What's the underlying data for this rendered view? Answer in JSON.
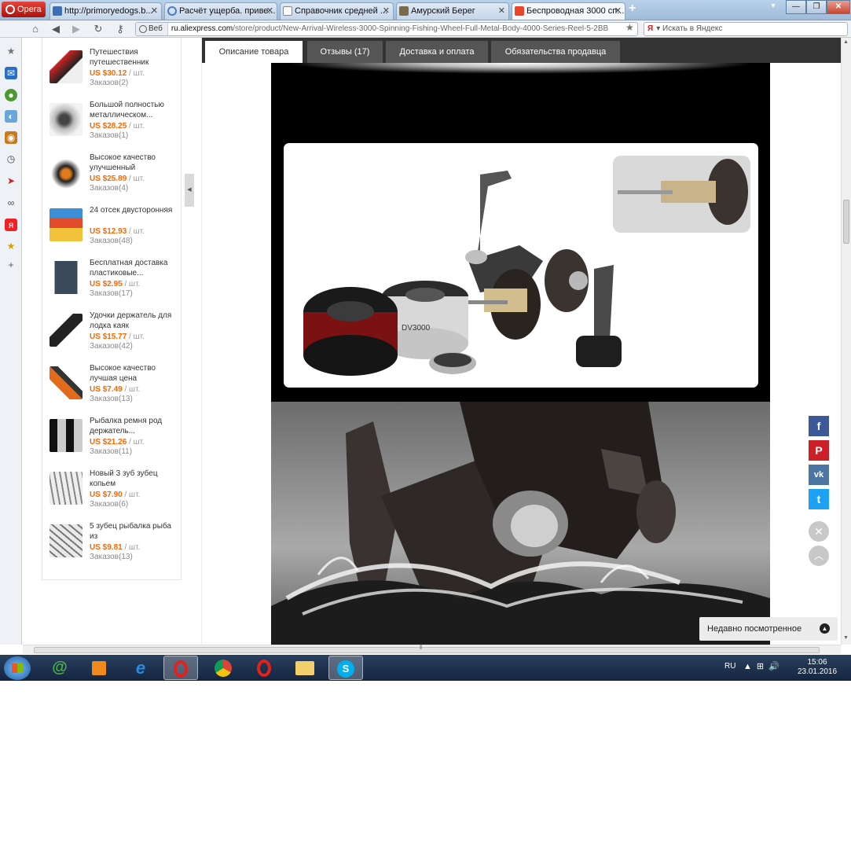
{
  "browser": {
    "menu_label": "Opera",
    "tabs": [
      {
        "title": "http://primoryedogs.b...",
        "color": "#3b6fb5"
      },
      {
        "title": "Расчёт ущерба. приве...",
        "color": "#4a7bc4"
      },
      {
        "title": "Справочник средней ...",
        "color": "#ffffff"
      },
      {
        "title": "Амурский Берег",
        "color": "#7a6a4a"
      },
      {
        "title": "Беспроводная 3000 сп...",
        "color": "#e8452c"
      }
    ],
    "address": {
      "web_badge": "Веб",
      "url_host": "ru.aliexpress.com",
      "url_path": "/store/product/New-Arrival-Wireless-3000-Spinning-Fishing-Wheel-Full-Metal-Body-4000-Series-Reel-5-2BB"
    },
    "search_placeholder": "Искать в Яндекс",
    "search_engine_badge": "Я"
  },
  "recommended": [
    {
      "title": "Путешествия путешественник",
      "price": "US $30.12",
      "unit": "/ шт.",
      "orders": "Заказов(2)"
    },
    {
      "title": "Большой полностью металлическом...",
      "price": "US $28.25",
      "unit": "/ шт.",
      "orders": "Заказов(1)"
    },
    {
      "title": "Высокое качество улучшенный",
      "price": "US $25.89",
      "unit": "/ шт.",
      "orders": "Заказов(4)"
    },
    {
      "title": "24 отсек двусторонняя",
      "price": "US $12.93",
      "unit": "/ шт.",
      "orders": "Заказов(48)"
    },
    {
      "title": "Бесплатная доставка пластиковые...",
      "price": "US $2.95",
      "unit": "/ шт.",
      "orders": "Заказов(17)"
    },
    {
      "title": "Удочки держатель для лодка каяк",
      "price": "US $15.77",
      "unit": "/ шт.",
      "orders": "Заказов(42)"
    },
    {
      "title": "Высокое качество лучшая цена",
      "price": "US $7.49",
      "unit": "/ шт.",
      "orders": "Заказов(13)"
    },
    {
      "title": "Рыбалка ремня род держатель...",
      "price": "US $21.26",
      "unit": "/ шт.",
      "orders": "Заказов(11)"
    },
    {
      "title": "Новый 3 зуб зубец копьем",
      "price": "US $7.90",
      "unit": "/ шт.",
      "orders": "Заказов(6)"
    },
    {
      "title": "5 зубец рыбалка рыба из",
      "price": "US $9.81",
      "unit": "/ шт.",
      "orders": "Заказов(13)"
    }
  ],
  "product_tabs": [
    {
      "label": "Описание товара"
    },
    {
      "label": "Отзывы (17)"
    },
    {
      "label": "Доставка и оплата"
    },
    {
      "label": "Обязательства продавца"
    }
  ],
  "reel_print": "DV3000",
  "recently_viewed": "Недавно посмотренное",
  "social": {
    "facebook": "f",
    "pinterest": "P",
    "vk": "vk",
    "twitter": "t"
  },
  "taskbar": {
    "lang": "RU",
    "time": "15:06",
    "date": "23.01.2016"
  },
  "colors": {
    "accent_price": "#ff6600",
    "facebook": "#3b5998",
    "pinterest": "#cb2027",
    "vk": "#4c75a3",
    "twitter": "#1da1f2"
  }
}
